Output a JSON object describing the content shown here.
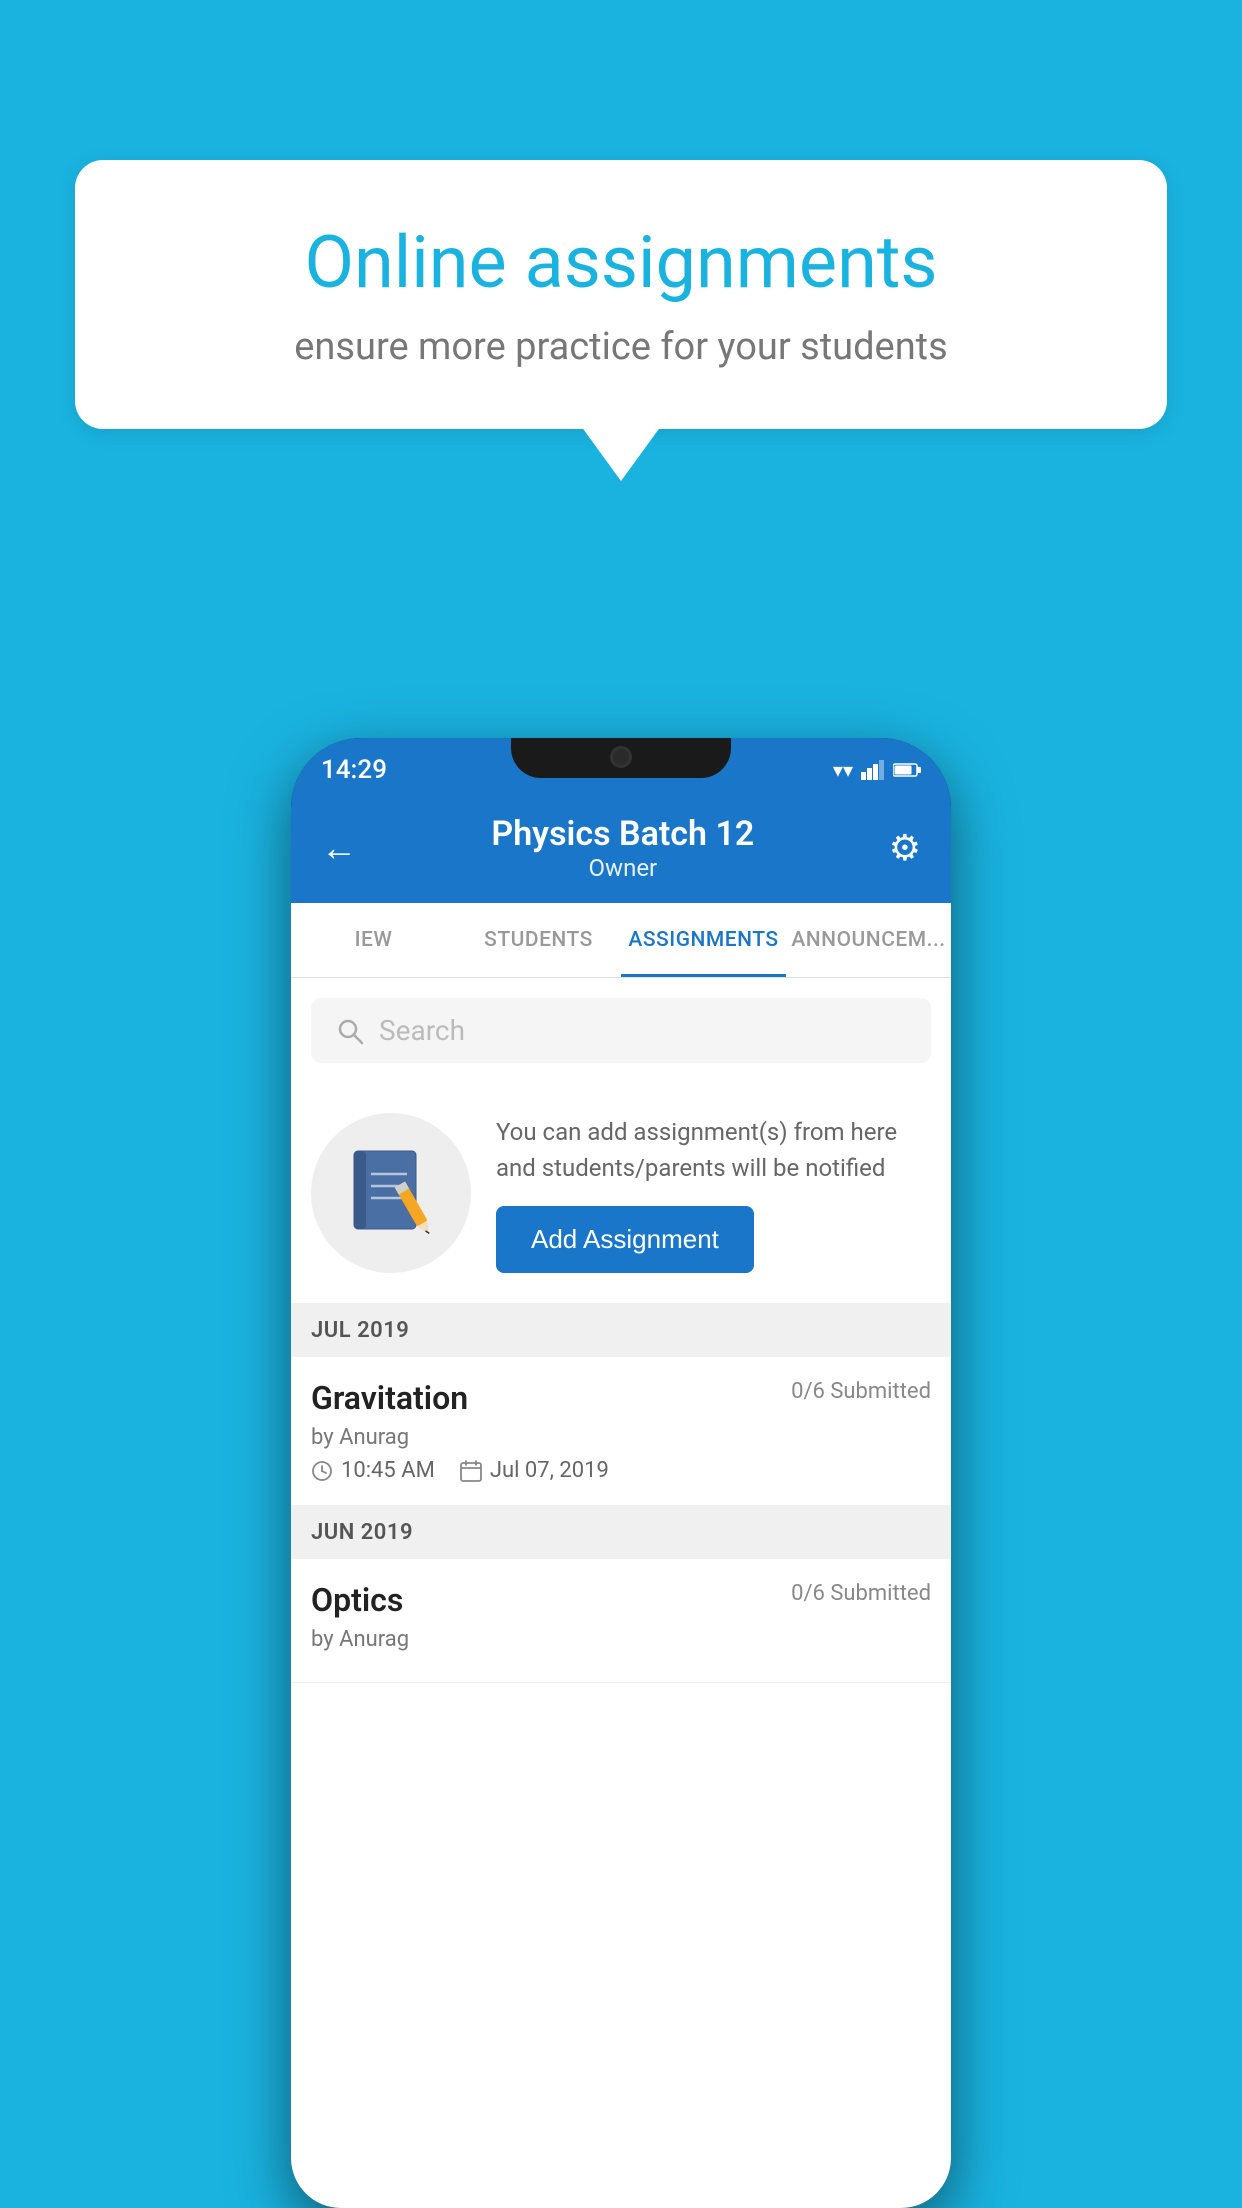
{
  "background": {
    "color": "#1ab3e0"
  },
  "speech_bubble": {
    "title": "Online assignments",
    "subtitle": "ensure more practice for your students"
  },
  "status_bar": {
    "time": "14:29",
    "icons": [
      "wifi",
      "signal",
      "battery"
    ]
  },
  "header": {
    "title": "Physics Batch 12",
    "subtitle": "Owner",
    "back_label": "←",
    "settings_label": "⚙"
  },
  "tabs": [
    {
      "id": "view",
      "label": "IEW",
      "active": false
    },
    {
      "id": "students",
      "label": "STUDENTS",
      "active": false
    },
    {
      "id": "assignments",
      "label": "ASSIGNMENTS",
      "active": true
    },
    {
      "id": "announcements",
      "label": "ANNOUNCEM...",
      "active": false
    }
  ],
  "search": {
    "placeholder": "Search"
  },
  "add_section": {
    "description": "You can add assignment(s) from here and students/parents will be notified",
    "button_label": "Add Assignment"
  },
  "sections": [
    {
      "label": "JUL 2019",
      "assignments": [
        {
          "name": "Gravitation",
          "submitted": "0/6 Submitted",
          "author": "by Anurag",
          "time": "10:45 AM",
          "date": "Jul 07, 2019"
        }
      ]
    },
    {
      "label": "JUN 2019",
      "assignments": [
        {
          "name": "Optics",
          "submitted": "0/6 Submitted",
          "author": "by Anurag",
          "time": "",
          "date": ""
        }
      ]
    }
  ]
}
